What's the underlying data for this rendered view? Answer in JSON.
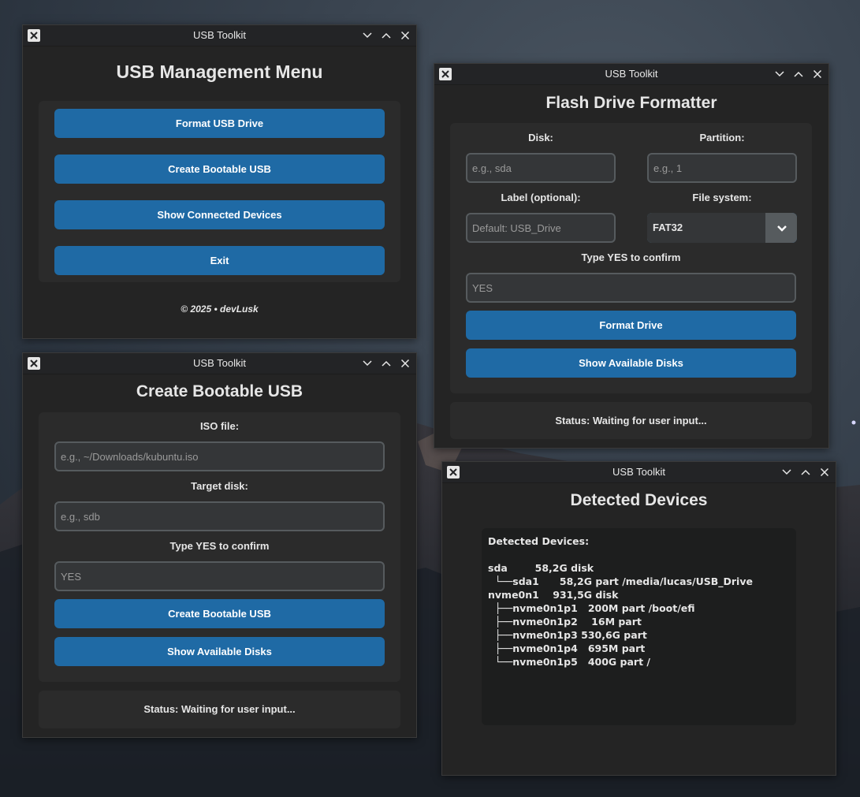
{
  "window_title": "USB Toolkit",
  "menu": {
    "heading": "USB Management Menu",
    "buttons": [
      "Format USB Drive",
      "Create Bootable USB",
      "Show Connected Devices",
      "Exit"
    ],
    "footer": "© 2025 • devLusk"
  },
  "formatter": {
    "heading": "Flash Drive Formatter",
    "disk_label": "Disk:",
    "disk_placeholder": "e.g., sda",
    "partition_label": "Partition:",
    "partition_placeholder": "e.g., 1",
    "volume_label": "Label (optional):",
    "volume_placeholder": "Default: USB_Drive",
    "fs_label": "File system:",
    "fs_value": "FAT32",
    "confirm_label": "Type YES to confirm",
    "confirm_placeholder": "YES",
    "format_button": "Format Drive",
    "show_disks_button": "Show Available Disks",
    "status": "Status: Waiting for user input..."
  },
  "bootable": {
    "heading": "Create Bootable USB",
    "iso_label": "ISO file:",
    "iso_placeholder": "e.g., ~/Downloads/kubuntu.iso",
    "target_label": "Target disk:",
    "target_placeholder": "e.g., sdb",
    "confirm_label": "Type YES to confirm",
    "confirm_placeholder": "YES",
    "create_button": "Create Bootable USB",
    "show_disks_button": "Show Available Disks",
    "status": "Status: Waiting for user input..."
  },
  "devices": {
    "heading": "Detected Devices",
    "output": "Detected Devices:\n\nsda        58,2G disk\n  └──sda1      58,2G part /media/lucas/USB_Drive\nnvme0n1    931,5G disk\n  ├──nvme0n1p1   200M part /boot/efi\n  ├──nvme0n1p2    16M part\n  ├──nvme0n1p3 530,6G part\n  ├──nvme0n1p4   695M part\n  └──nvme0n1p5   400G part /"
  }
}
